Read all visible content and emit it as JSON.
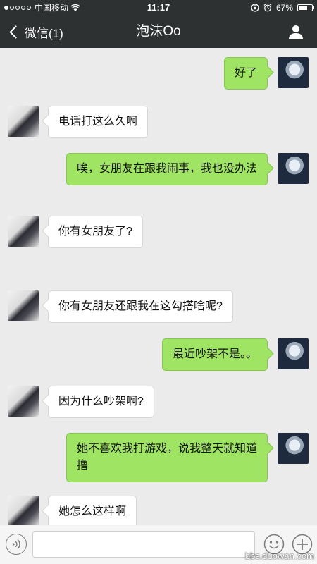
{
  "status_bar": {
    "carrier": "中国移动",
    "time": "11:17",
    "battery_percent": "67%",
    "battery_level": 0.67,
    "icons": [
      "signal-dots-icon",
      "wifi-icon",
      "rotation-lock-icon",
      "alarm-icon",
      "battery-icon"
    ]
  },
  "nav": {
    "back_label": "微信(1)",
    "title": "泡沫Oo",
    "right_icon": "person-icon"
  },
  "messages": [
    {
      "side": "right",
      "text": "好了"
    },
    {
      "side": "left",
      "text": "电话打这么久啊"
    },
    {
      "side": "right",
      "text": "唉，女朋友在跟我闹事，我也没办法"
    },
    {
      "side": "left",
      "text": "你有女朋友了?"
    },
    {
      "side": "left",
      "text": "你有女朋友还跟我在这勾搭啥呢?"
    },
    {
      "side": "right",
      "text": "最近吵架不是。。"
    },
    {
      "side": "left",
      "text": "因为什么吵架啊?"
    },
    {
      "side": "right",
      "text": "她不喜欢我打游戏，说我整天就知道撸"
    },
    {
      "side": "left",
      "text": "她怎么这样啊"
    }
  ],
  "input_bar": {
    "icons": [
      "voice-icon",
      "emoji-icon",
      "plus-icon"
    ],
    "value": ""
  },
  "watermark": "bbs.duowan.com",
  "colors": {
    "nav_bg": "#2e3132",
    "chat_bg": "#ebebeb",
    "bubble_sent": "#9fe462",
    "bubble_received": "#ffffff"
  }
}
